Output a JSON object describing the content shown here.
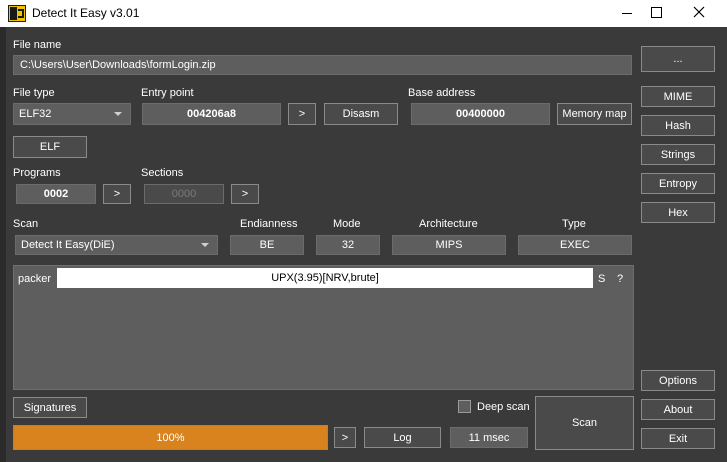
{
  "window": {
    "title": "Detect It Easy v3.01"
  },
  "file_name": {
    "label": "File name",
    "value": "C:\\Users\\User\\Downloads\\formLogin.zip",
    "browse_label": "..."
  },
  "file_type": {
    "label": "File type",
    "value": "ELF32",
    "elf_button": "ELF"
  },
  "entry_point": {
    "label": "Entry point",
    "value": "004206a8",
    "next_label": ">",
    "disasm_label": "Disasm"
  },
  "base_address": {
    "label": "Base address",
    "value": "00400000",
    "memory_map_label": "Memory map"
  },
  "programs": {
    "label": "Programs",
    "value": "0002",
    "next_label": ">"
  },
  "sections": {
    "label": "Sections",
    "value": "0000",
    "next_label": ">"
  },
  "scan": {
    "label": "Scan",
    "engine": "Detect It Easy(DiE)",
    "endianness_label": "Endianness",
    "endianness": "BE",
    "mode_label": "Mode",
    "mode": "32",
    "architecture_label": "Architecture",
    "architecture": "MIPS",
    "type_label": "Type",
    "type": "EXEC"
  },
  "results": [
    {
      "kind": "packer",
      "name": "UPX(3.95)[NRV,brute]",
      "s_label": "S",
      "info_label": "?"
    }
  ],
  "side_buttons": {
    "mime": "MIME",
    "hash": "Hash",
    "strings": "Strings",
    "entropy": "Entropy",
    "hex": "Hex",
    "options": "Options",
    "about": "About",
    "exit": "Exit"
  },
  "bottom": {
    "signatures_label": "Signatures",
    "deep_scan_label": "Deep scan",
    "deep_scan_checked": false,
    "progress_value": 100,
    "progress_label": "100%",
    "progress_next_label": ">",
    "log_label": "Log",
    "elapsed": "11 msec",
    "scan_label": "Scan"
  },
  "colors": {
    "accent": "#d9831f",
    "background": "#3a3a3a",
    "field": "#5e5e5e"
  }
}
